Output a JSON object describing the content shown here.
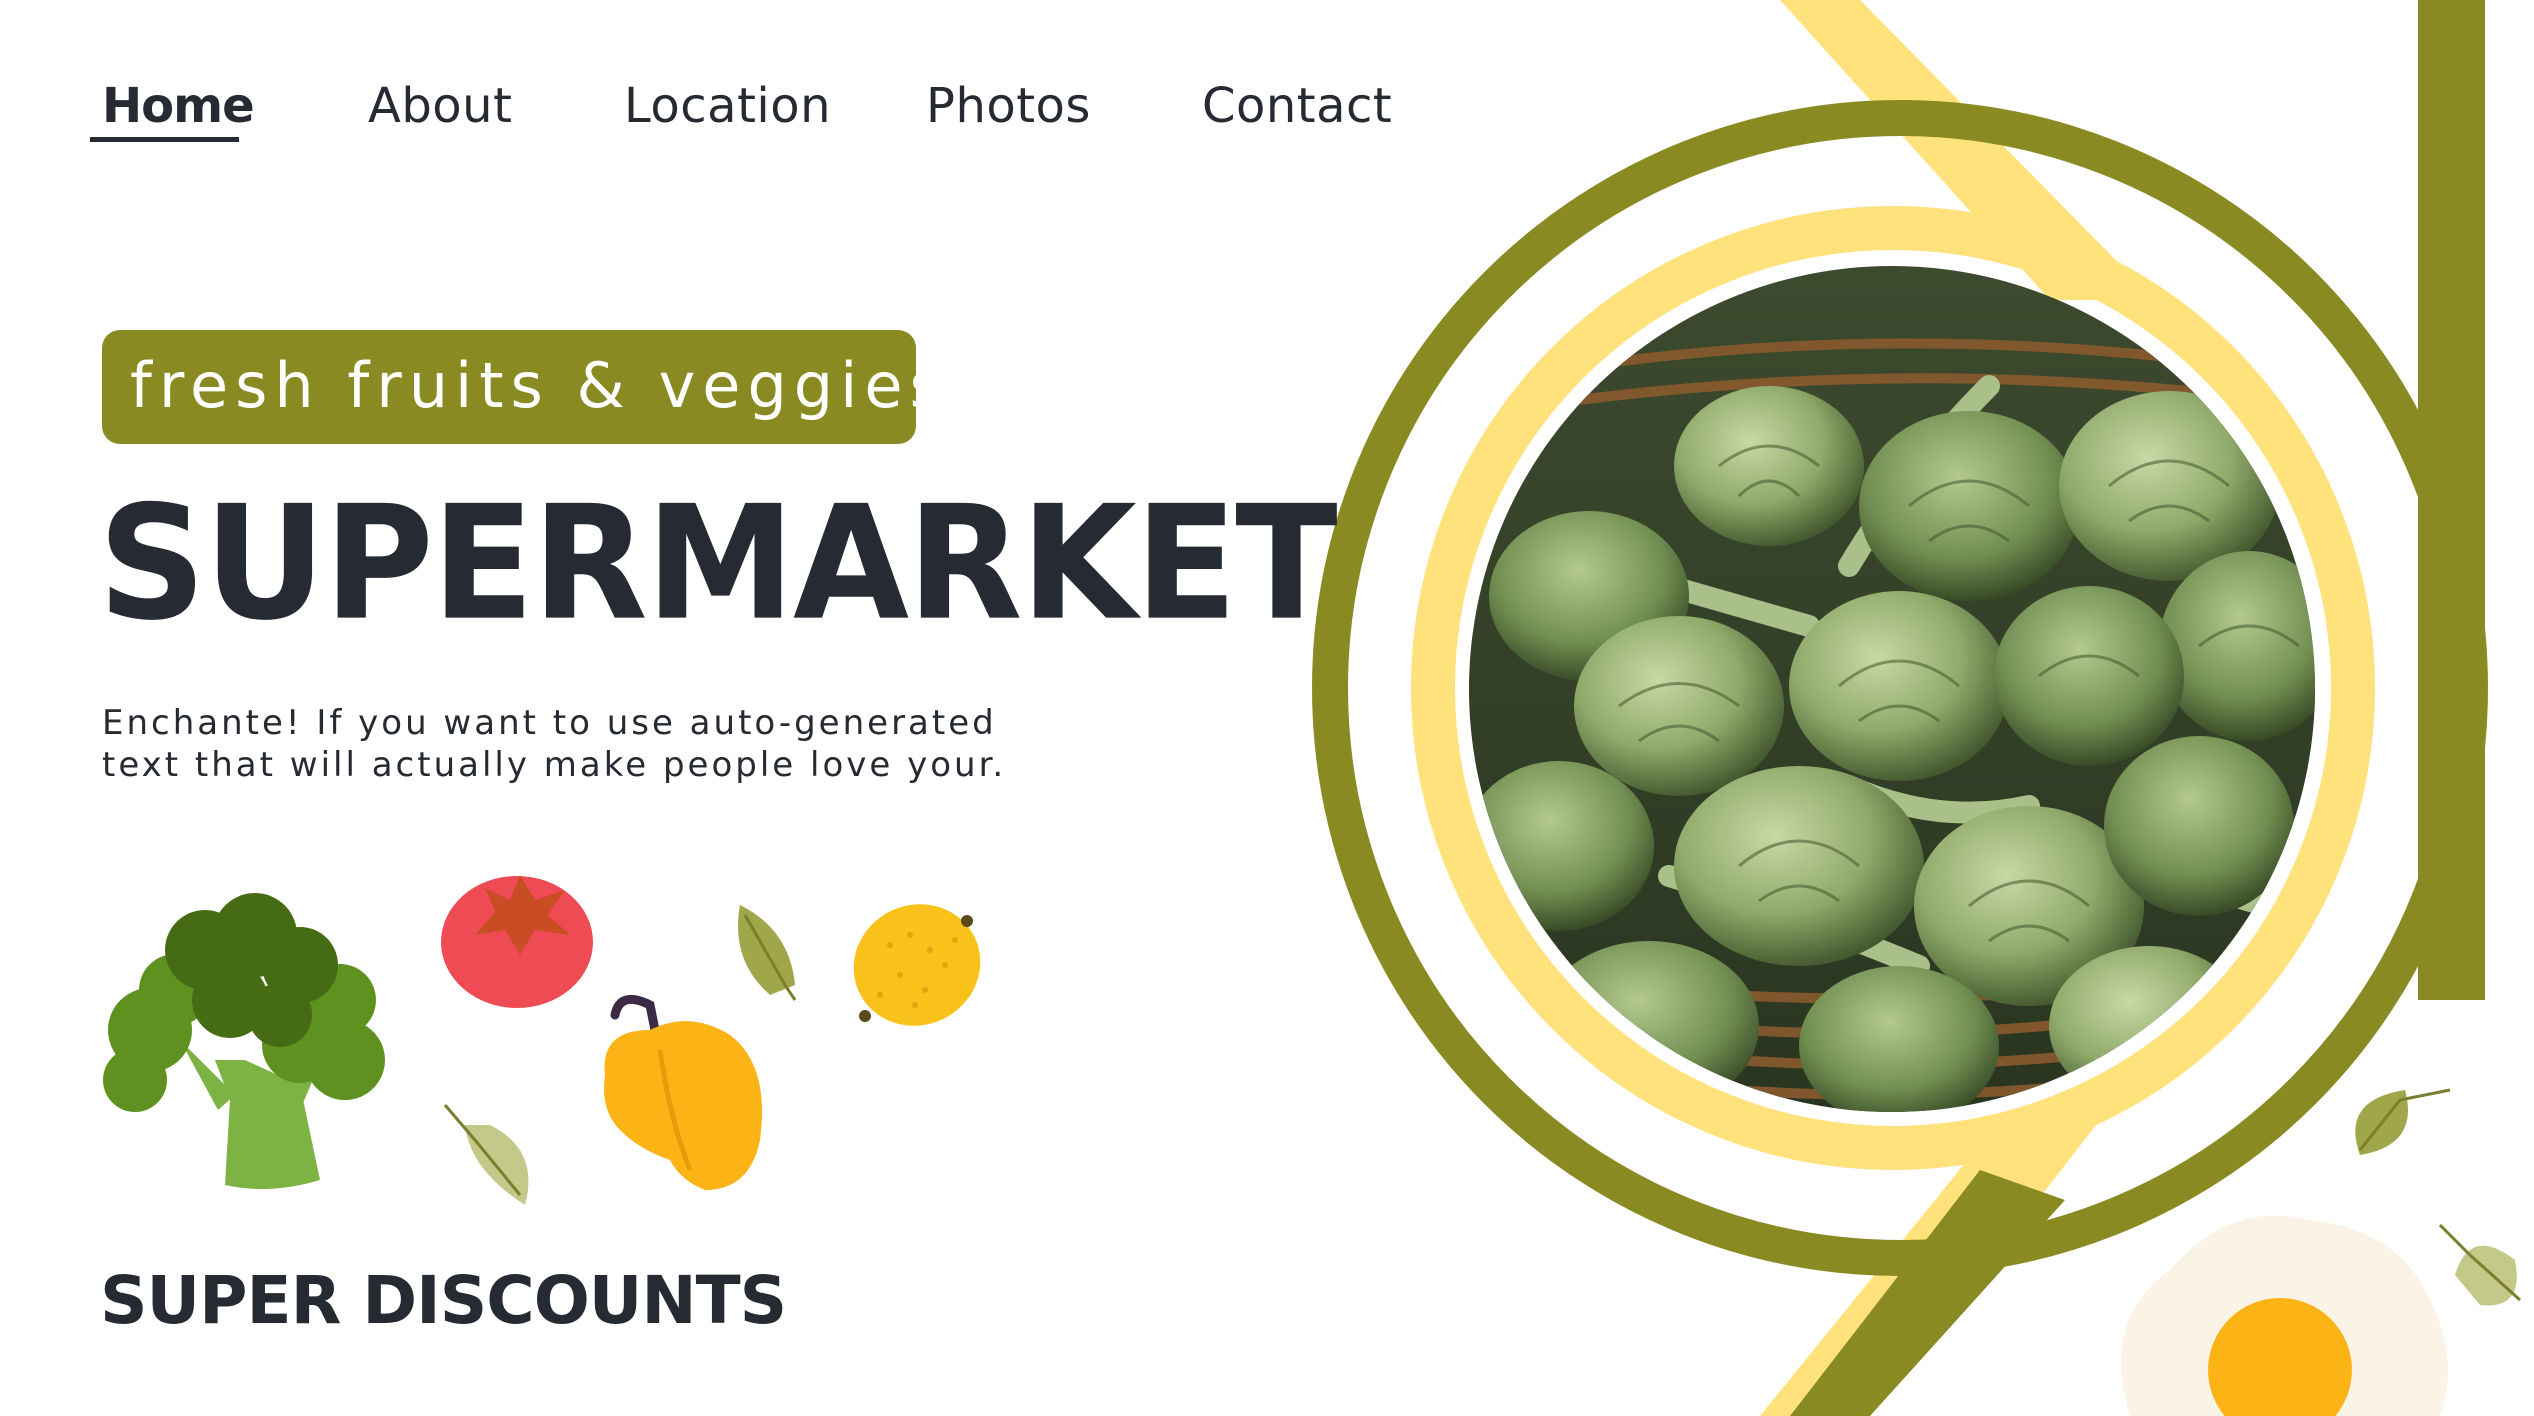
{
  "nav": {
    "items": [
      {
        "label": "Home",
        "active": true
      },
      {
        "label": "About",
        "active": false
      },
      {
        "label": "Location",
        "active": false
      },
      {
        "label": "Photos",
        "active": false
      },
      {
        "label": "Contact",
        "active": false
      }
    ]
  },
  "hero": {
    "tagline": "fresh fruits & veggies",
    "headline": "SUPERMARKET",
    "description_line1": "Enchante! If you want to use auto-generated",
    "description_line2": "text that will actually make people love your.",
    "subheading": "SUPER DISCOUNTS",
    "photo_subject": "artichokes-in-basket"
  },
  "illustrations": [
    "broccoli-icon",
    "tomato-icon",
    "leaf-icon",
    "lemon-icon",
    "bell-pepper-icon",
    "fried-egg-icon"
  ],
  "colors": {
    "olive": "#8a8a22",
    "yellow": "#ffe27c",
    "text": "#262b33",
    "tomato": "#ef4b55",
    "pepper": "#fcb316",
    "lemon": "#f9c21a",
    "broccoli_dark": "#456c14",
    "broccoli_light": "#7cb342"
  }
}
